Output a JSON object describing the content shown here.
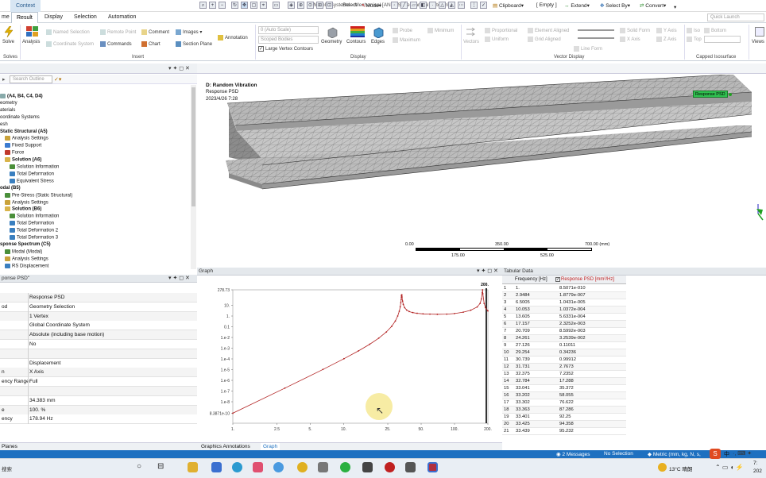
{
  "window": {
    "context_tab": "Context",
    "title": "Multiple Systems - Mechanical [ANSYS Mechanical Enterprise]",
    "quick_launch": "Quick Launch"
  },
  "tabs": [
    "me",
    "Result",
    "Display",
    "Selection",
    "Automation"
  ],
  "ribbon": {
    "solve": "Solve",
    "solves_group": "Solves",
    "analysis": "Analysis",
    "named_selection": "Named Selection",
    "coordinate_system": "Coordinate System",
    "remote_point": "Remote Point",
    "commands": "Commands",
    "comment": "Comment",
    "chart": "Chart",
    "images": "Images",
    "section_plane": "Section Plane",
    "annotation": "Annotation",
    "insert_group": "Insert",
    "scale_select": "0 (Auto Scale)",
    "scoped_bodies": "Scoped Bodies",
    "large_vertex": "Large Vertex Contours",
    "geometry": "Geometry",
    "contours": "Contours",
    "edges": "Edges",
    "probe": "Probe",
    "maximum": "Maximum",
    "minimum": "Minimum",
    "display_group": "Display",
    "vectors": "Vectors",
    "proportional": "Proportional",
    "uniform": "Uniform",
    "element_aligned": "Element Aligned",
    "grid_aligned": "Grid Aligned",
    "line_form": "Line Form",
    "solid_form": "Solid Form",
    "x_axis": "X Axis",
    "y_axis": "Y Axis",
    "z_axis": "Z Axis",
    "vector_display_group": "Vector Display",
    "iso": "Iso",
    "top": "Top",
    "bottom": "Bottom",
    "capped_group": "Capped Isosurface",
    "views": "Views"
  },
  "toolbar": {
    "select": "Select",
    "mode": "Mode",
    "clipboard": "Clipboard",
    "empty": "[ Empty ]",
    "extend": "Extend",
    "select_by": "Select By",
    "convert": "Convert"
  },
  "outline": {
    "search_placeholder": "Search Outline",
    "items": [
      {
        "label": "(A4, B4, C4, D4)",
        "bold": true,
        "indent": 0,
        "icon": "#8aa"
      },
      {
        "label": "eometry",
        "bold": false,
        "indent": 0,
        "icon": ""
      },
      {
        "label": "aterials",
        "bold": false,
        "indent": 0,
        "icon": ""
      },
      {
        "label": "oordinate Systems",
        "bold": false,
        "indent": 0,
        "icon": ""
      },
      {
        "label": "esh",
        "bold": false,
        "indent": 0,
        "icon": ""
      },
      {
        "label": "Static Structural (A5)",
        "bold": true,
        "indent": 0,
        "icon": ""
      },
      {
        "label": "Analysis Settings",
        "bold": false,
        "indent": 1,
        "icon": "#c9a23a"
      },
      {
        "label": "Fixed Support",
        "bold": false,
        "indent": 1,
        "icon": "#3b7bd0"
      },
      {
        "label": "Force",
        "bold": false,
        "indent": 1,
        "icon": "#c0392b"
      },
      {
        "label": "Solution (A6)",
        "bold": true,
        "indent": 1,
        "icon": "#d9b44a"
      },
      {
        "label": "Solution Information",
        "bold": false,
        "indent": 2,
        "icon": "#4a8f3a"
      },
      {
        "label": "Total Deformation",
        "bold": false,
        "indent": 2,
        "icon": "#3a7fbf"
      },
      {
        "label": "Equivalent Stress",
        "bold": false,
        "indent": 2,
        "icon": "#3a7fbf"
      },
      {
        "label": "odal (B5)",
        "bold": true,
        "indent": 0,
        "icon": ""
      },
      {
        "label": "Pre-Stress (Static Structural)",
        "bold": false,
        "indent": 1,
        "icon": "#4a8f3a"
      },
      {
        "label": "Analysis Settings",
        "bold": false,
        "indent": 1,
        "icon": "#c9a23a"
      },
      {
        "label": "Solution (B6)",
        "bold": true,
        "indent": 1,
        "icon": "#d9b44a"
      },
      {
        "label": "Solution Information",
        "bold": false,
        "indent": 2,
        "icon": "#4a8f3a"
      },
      {
        "label": "Total Deformation",
        "bold": false,
        "indent": 2,
        "icon": "#3a7fbf"
      },
      {
        "label": "Total Deformation 2",
        "bold": false,
        "indent": 2,
        "icon": "#3a7fbf"
      },
      {
        "label": "Total Deformation 3",
        "bold": false,
        "indent": 2,
        "icon": "#3a7fbf"
      },
      {
        "label": "sponse Spectrum (C5)",
        "bold": true,
        "indent": 0,
        "icon": ""
      },
      {
        "label": "Modal (Modal)",
        "bold": false,
        "indent": 1,
        "icon": "#4a8f3a"
      },
      {
        "label": "Analysis Settings",
        "bold": false,
        "indent": 1,
        "icon": "#c9a23a"
      },
      {
        "label": "RS Displacement",
        "bold": false,
        "indent": 1,
        "icon": "#3a7fbf"
      },
      {
        "label": "Solution (C6)",
        "bold": true,
        "indent": 1,
        "icon": "#d9b44a"
      }
    ]
  },
  "details": {
    "header": "ponse PSD\"",
    "rows": [
      {
        "k": "",
        "v": "Response PSD"
      },
      {
        "k": "od",
        "v": "Geometry Selection"
      },
      {
        "k": "",
        "v": "1 Vertex"
      },
      {
        "k": "",
        "v": "Global Coordinate System"
      },
      {
        "k": "",
        "v": "Absolute (including base motion)"
      },
      {
        "k": "",
        "v": "No"
      },
      {
        "k": "",
        "v": ""
      },
      {
        "k": "",
        "v": "Displacement"
      },
      {
        "k": "n",
        "v": "X Axis"
      },
      {
        "k": "ency Range",
        "v": "Full"
      },
      {
        "k": "",
        "v": ""
      },
      {
        "k": "",
        "v": "34.383 mm"
      },
      {
        "k": "e",
        "v": "100. %"
      },
      {
        "k": "ency",
        "v": "178.94 Hz"
      }
    ],
    "footer_tab": "Planes"
  },
  "viewport": {
    "analysis_name": "D: Random Vibration",
    "result_name": "Response PSD",
    "date": "2023/4/26 7:28",
    "probe_label": "Response PSD",
    "scale_top": [
      "0.00",
      "350.00",
      "700.00 (mm)"
    ],
    "scale_bottom": [
      "175.00",
      "525.00"
    ]
  },
  "graph": {
    "title": "Graph",
    "tabs": [
      "Graphics Annotations",
      "Graph"
    ],
    "end_label": "200."
  },
  "tabular": {
    "title": "Tabular Data",
    "col_freq": "Frequency [Hz]",
    "col_val": "Response PSD [mm²/Hz]",
    "rows": [
      [
        "1",
        "1.",
        "8.5071e-010"
      ],
      [
        "2",
        "2.9484",
        "1.8779e-007"
      ],
      [
        "3",
        "6.5005",
        "1.0431e-005"
      ],
      [
        "4",
        "10.053",
        "1.0372e-004"
      ],
      [
        "5",
        "13.605",
        "5.6331e-004"
      ],
      [
        "6",
        "17.157",
        "2.3252e-003"
      ],
      [
        "7",
        "20.709",
        "8.5992e-003"
      ],
      [
        "8",
        "24.261",
        "3.2539e-002"
      ],
      [
        "9",
        "27.126",
        "0.11011"
      ],
      [
        "10",
        "29.254",
        "0.34236"
      ],
      [
        "11",
        "30.739",
        "0.99912"
      ],
      [
        "12",
        "31.731",
        "2.7673"
      ],
      [
        "13",
        "32.375",
        "7.2352"
      ],
      [
        "14",
        "32.784",
        "17.288"
      ],
      [
        "15",
        "33.041",
        "35.372"
      ],
      [
        "16",
        "33.202",
        "58.055"
      ],
      [
        "17",
        "33.302",
        "76.622"
      ],
      [
        "18",
        "33.363",
        "87.286"
      ],
      [
        "19",
        "33.401",
        "92.25"
      ],
      [
        "20",
        "33.425",
        "94.358"
      ],
      [
        "21",
        "33.439",
        "95.232"
      ]
    ]
  },
  "status": {
    "messages": "2 Messages",
    "selection": "No Selection",
    "units": "Metric (mm, kg, N, s,"
  },
  "taskbar": {
    "search": "搜索",
    "weather": "13°C 晴朗",
    "ime": "中",
    "time": "7:",
    "date": "202"
  },
  "chart_data": {
    "type": "line",
    "title": "",
    "xscale": "log",
    "yscale": "log",
    "xlim": [
      1,
      200
    ],
    "ylim": [
      1e-10,
      278.73
    ],
    "x_ticks": [
      "1.",
      "2.5",
      "5.",
      "10.",
      "25.",
      "50.",
      "100.",
      "200."
    ],
    "y_ticks": [
      "278.73",
      "10.",
      "1.",
      "0.1",
      "1.e-2",
      "1.e-3",
      "1.e-4",
      "1.e-5",
      "1.e-6",
      "1.e-7",
      "1.e-8",
      "8.3871e-10"
    ],
    "series": [
      {
        "color": "#b22222",
        "x": [
          1,
          2.9484,
          6.5005,
          10.053,
          13.605,
          17.157,
          20.709,
          24.261,
          27.126,
          29.254,
          30.739,
          31.731,
          32.375,
          32.784,
          33.041,
          33.202,
          33.302,
          33.363,
          33.401,
          33.425,
          33.439,
          33.6,
          34,
          34.5,
          35.5,
          37,
          39,
          42,
          46,
          52,
          60,
          70,
          85,
          100,
          120,
          140,
          160,
          170,
          175,
          178,
          178.94,
          180,
          185,
          190,
          200
        ],
        "y": [
          8.5071e-10,
          1.8779e-07,
          1.0431e-05,
          0.00010372,
          0.00056331,
          0.0023252,
          0.0085992,
          0.032539,
          0.11011,
          0.34236,
          0.99912,
          2.7673,
          7.2352,
          17.288,
          35.372,
          58.055,
          76.622,
          87.286,
          92.25,
          94.358,
          95.232,
          60,
          25,
          12,
          6,
          3.6,
          2.6,
          2.1,
          1.8,
          1.6,
          1.5,
          1.45,
          1.5,
          1.7,
          2.3,
          3.5,
          7,
          15,
          40,
          150,
          278.73,
          120,
          15,
          6,
          3
        ]
      }
    ]
  }
}
